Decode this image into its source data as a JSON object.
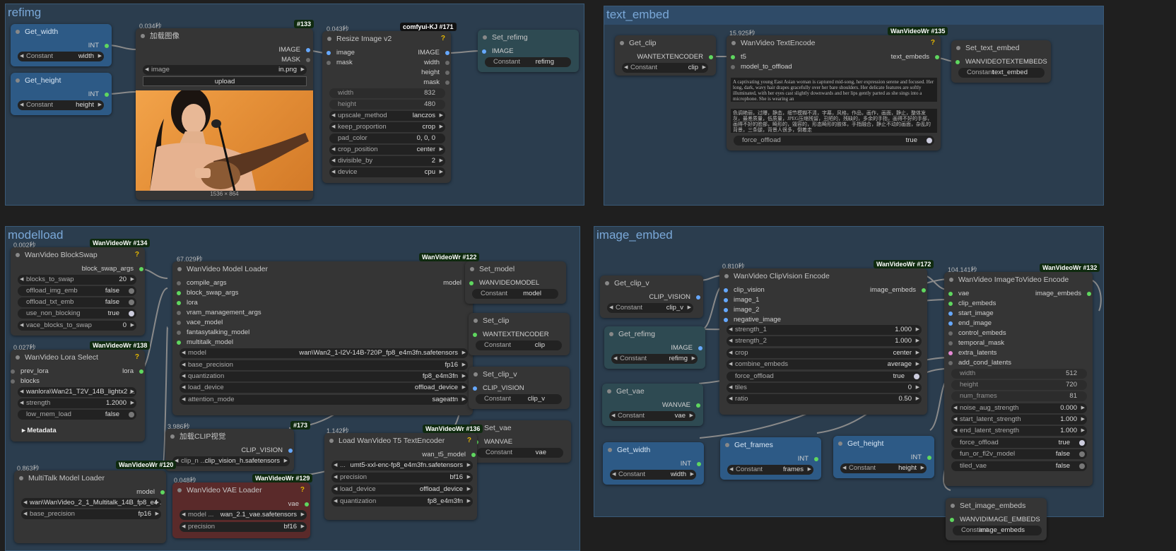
{
  "groups": {
    "refimg": "refimg",
    "text_embed": "text_embed",
    "modelload": "modelload",
    "image_embed": "image_embed"
  },
  "colors": {
    "group_bg": "#2b3d4e",
    "node_bg": "#353535",
    "node_blue": "#2d5a86",
    "wire": "#8a8a8a",
    "link_green": "#5fd75f"
  },
  "common": {
    "constant": "Constant",
    "int": "INT",
    "image": "IMAGE",
    "mask": "MASK",
    "width": "width",
    "height": "height"
  },
  "get_width": {
    "title": "Get_width",
    "value": "width"
  },
  "get_height": {
    "title": "Get_height",
    "value": "height"
  },
  "load_image": {
    "time": "0.034秒",
    "id": "#133",
    "title": "加载图像",
    "out1": "IMAGE",
    "out2": "MASK",
    "wl": "image",
    "wv": "in.png",
    "upload": "upload",
    "size": "1536 × 864"
  },
  "resize": {
    "time": "0.043秒",
    "tag": "comfyui-KJ",
    "id": "#171",
    "title": "Resize Image v2",
    "q": "?",
    "ins": [
      "image",
      "mask"
    ],
    "outs": [
      "IMAGE",
      "width",
      "height",
      "mask"
    ],
    "widgets": [
      [
        "width",
        "832"
      ],
      [
        "height",
        "480"
      ],
      [
        "upscale_method",
        "lanczos"
      ],
      [
        "keep_proportion",
        "crop"
      ],
      [
        "pad_color",
        "0, 0, 0"
      ],
      [
        "crop_position",
        "center"
      ],
      [
        "divisible_by",
        "2"
      ],
      [
        "device",
        "cpu"
      ]
    ]
  },
  "set_refimg": {
    "title": "Set_refimg",
    "input": "IMAGE",
    "value": "refimg"
  },
  "get_clip": {
    "title": "Get_clip",
    "out": "WANTEXTENCODER",
    "value": "clip"
  },
  "text_encode": {
    "time": "15.925秒",
    "tag": "WanVideoWr",
    "id": "#135",
    "title": "WanVideo TextEncode",
    "q": "?",
    "in1": "t5",
    "in2": "model_to_offload",
    "out": "text_embeds",
    "pos": "A captivating young East Asian woman is captured mid-song, her expression serene and focused. Her long, dark, wavy hair drapes gracefully over her bare shoulders. Her delicate features are softly illuminated, with her eyes cast slightly downwards and her lips gently parted as she sings into a microphone. She is wearing an",
    "neg": "色调艳丽，过曝，静态，细节模糊不清，字幕，风格，作品，画作，画面，静止，整体发灰，最差质量，低质量，JPEG压缩残留，丑陋的，残缺的，多余的手指，画得不好的手部，画得不好的脸部，畸形的，毁容的，形态畸形的肢体，手指融合，静止不动的画面，杂乱的背景，三条腿，背景人很多，倒着走",
    "fo": "force_offload",
    "fov": "true"
  },
  "set_text_embed": {
    "title": "Set_text_embed",
    "input": "WANVIDEOTEXTEMBEDS",
    "value": "text_embed"
  },
  "blockswap": {
    "time": "0.002秒",
    "tag": "WanVideoWr",
    "id": "#134",
    "title": "WanVideo BlockSwap",
    "q": "?",
    "out": "block_swap_args",
    "widgets": [
      [
        "blocks_to_swap",
        "20"
      ],
      [
        "offload_img_emb",
        "false"
      ],
      [
        "offload_txt_emb",
        "false"
      ],
      [
        "use_non_blocking",
        "true"
      ],
      [
        "vace_blocks_to_swap",
        "0"
      ]
    ]
  },
  "lora": {
    "time": "0.027秒",
    "tag": "WanVideoWr",
    "id": "#138",
    "title": "WanVideo Lora Select",
    "q": "?",
    "in1": "prev_lora",
    "in2": "blocks",
    "out": "lora",
    "widgets": [
      [
        "lora",
        "wanlora\\Wan21_T2V_14B_lightx2 ..."
      ],
      [
        "strength",
        "1.2000"
      ],
      [
        "low_mem_load",
        "false"
      ]
    ],
    "meta": "Metadata"
  },
  "multitalk": {
    "time": "0.863秒",
    "tag": "WanVideoWr",
    "id": "#120",
    "title": "MultiTalk Model Loader",
    "out": "model",
    "widgets": [
      [
        "model",
        "wan\\WanVideo_2_1_Multitalk_14B_fp8_e4 ..."
      ],
      [
        "base_precision",
        "fp16"
      ]
    ]
  },
  "model_loader": {
    "time": "67.029秒",
    "tag": "WanVideoWr",
    "id": "#122",
    "title": "WanVideo Model Loader",
    "out": "model",
    "ins": [
      "compile_args",
      "block_swap_args",
      "lora",
      "vram_management_args",
      "vace_model",
      "fantasytalking_model",
      "multitalk_model"
    ],
    "widgets": [
      [
        "model",
        "wan\\Wan2_1-I2V-14B-720P_fp8_e4m3fn.safetensors"
      ],
      [
        "base_precision",
        "fp16"
      ],
      [
        "quantization",
        "fp8_e4m3fn"
      ],
      [
        "load_device",
        "offload_device"
      ],
      [
        "attention_mode",
        "sageattn"
      ]
    ]
  },
  "set_model": {
    "title": "Set_model",
    "input": "WANVIDEOMODEL",
    "value": "model"
  },
  "set_clip": {
    "title": "Set_clip",
    "input": "WANTEXTENCODER",
    "value": "clip"
  },
  "set_clip_v": {
    "title": "Set_clip_v",
    "input": "CLIP_VISION",
    "value": "clip_v"
  },
  "set_vae": {
    "title": "Set_vae",
    "input": "WANVAE",
    "value": "vae"
  },
  "clip_vision": {
    "time": "3.986秒",
    "id": "#173",
    "title": "加载CLIP视觉",
    "out": "CLIP_VISION",
    "wl": "clip_n ...",
    "wv": "clip_vision_h.safetensors"
  },
  "vae_loader": {
    "time": "0.048秒",
    "tag": "WanVideoWr",
    "id": "#129",
    "title": "WanVideo VAE Loader",
    "q": "?",
    "out": "vae",
    "widgets": [
      [
        "model ...",
        "wan_2.1_vae.safetensors"
      ],
      [
        "precision",
        "bf16"
      ]
    ]
  },
  "t5": {
    "time": "1.142秒",
    "tag": "WanVideoWr",
    "id": "#136",
    "title": "Load WanVideo T5 TextEncoder",
    "q": "?",
    "out": "wan_t5_model",
    "widgets": [
      [
        "...",
        "umt5-xxl-enc-fp8_e4m3fn.safetensors"
      ],
      [
        "precision",
        "bf16"
      ],
      [
        "load_device",
        "offload_device"
      ],
      [
        "quantization",
        "fp8_e4m3fn"
      ]
    ]
  },
  "get_clip_v": {
    "title": "Get_clip_v",
    "out": "CLIP_VISION",
    "value": "clip_v"
  },
  "get_refimg": {
    "title": "Get_refimg",
    "out": "IMAGE",
    "value": "refimg"
  },
  "get_vae": {
    "title": "Get_vae",
    "out": "WANVAE",
    "value": "vae"
  },
  "get_width2": {
    "title": "Get_width",
    "value": "width"
  },
  "get_frames": {
    "title": "Get_frames",
    "value": "frames"
  },
  "get_height2": {
    "title": "Get_height",
    "value": "height"
  },
  "cv_encode": {
    "time": "0.810秒",
    "tag": "WanVideoWr",
    "id": "#172",
    "title": "WanVideo ClipVision Encode",
    "out": "image_embeds",
    "ins": [
      "clip_vision",
      "image_1",
      "image_2",
      "negative_image"
    ],
    "widgets": [
      [
        "strength_1",
        "1.000"
      ],
      [
        "strength_2",
        "1.000"
      ],
      [
        "crop",
        "center"
      ],
      [
        "combine_embeds",
        "average"
      ],
      [
        "force_offload",
        "true"
      ],
      [
        "tiles",
        "0"
      ],
      [
        "ratio",
        "0.50"
      ]
    ]
  },
  "i2v_encode": {
    "time": "104.141秒",
    "tag": "WanVideoWr",
    "id": "#132",
    "title": "WanVideo ImageToVideo Encode",
    "out": "image_embeds",
    "ins": [
      "vae",
      "clip_embeds",
      "start_image",
      "end_image",
      "control_embeds",
      "temporal_mask",
      "extra_latents",
      "add_cond_latents"
    ],
    "widgets": [
      [
        "width",
        "512"
      ],
      [
        "height",
        "720"
      ],
      [
        "num_frames",
        "81"
      ],
      [
        "noise_aug_strength",
        "0.000"
      ],
      [
        "start_latent_strength",
        "1.000"
      ],
      [
        "end_latent_strength",
        "1.000"
      ],
      [
        "force_offload",
        "true"
      ],
      [
        "fun_or_fl2v_model",
        "false"
      ],
      [
        "tiled_vae",
        "false"
      ]
    ]
  },
  "set_image_embeds": {
    "title": "Set_image_embeds",
    "input": "WANVIDIMAGE_EMBEDS",
    "value": "image_embeds"
  }
}
